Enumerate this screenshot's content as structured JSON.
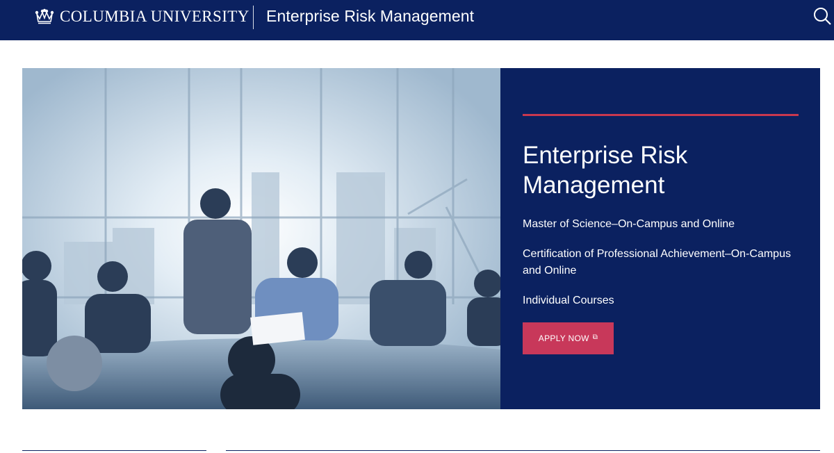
{
  "header": {
    "university": "COLUMBIA UNIVERSITY",
    "site_title": "Enterprise Risk Management",
    "brand_color": "#0b2160",
    "icons": {
      "logo": "crown-icon",
      "search": "search-icon"
    }
  },
  "hero": {
    "image_alt": "business-meeting-photo",
    "title": "Enterprise Risk Management",
    "options": [
      "Master of Science–On-Campus and Online",
      "Certification of Professional Achievement–On-Campus and Online",
      "Individual Courses"
    ],
    "apply_label": "APPLY NOW",
    "accent_color": "#c8384f",
    "button_color": "#c8385a"
  }
}
